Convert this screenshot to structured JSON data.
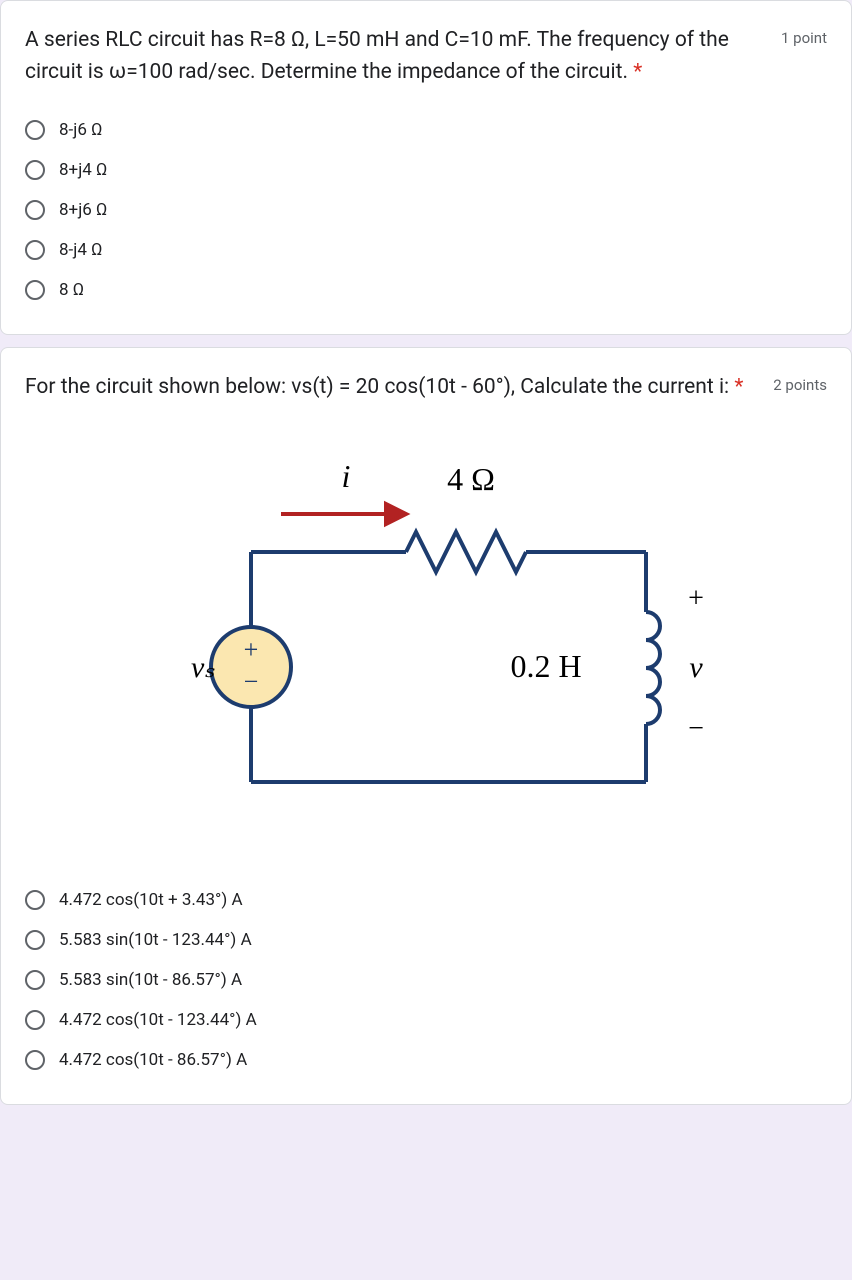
{
  "q1": {
    "text": "A series RLC circuit has R=8 Ω, L=50 mH and C=10 mF. The frequency of the circuit is ω=100 rad/sec. Determine the impedance of the circuit.",
    "points": "1 point",
    "options": [
      "8-j6 Ω",
      "8+j4 Ω",
      "8+j6 Ω",
      "8-j4 Ω",
      "8 Ω"
    ]
  },
  "q2": {
    "text": "For the circuit shown below: vs(t) = 20 cos(10t - 60°), Calculate the current i:",
    "points": "2 points",
    "options": [
      "4.472 cos(10t + 3.43°) A",
      "5.583 sin(10t - 123.44°) A",
      "5.583 sin(10t - 86.57°) A",
      "4.472 cos(10t - 123.44°) A",
      "4.472 cos(10t - 86.57°) A"
    ]
  },
  "circuit": {
    "i_label": "i",
    "r_label": "4 Ω",
    "l_label": "0.2 H",
    "vs_label": "vₛ",
    "v_label": "v",
    "plus": "+",
    "minus": "−"
  }
}
